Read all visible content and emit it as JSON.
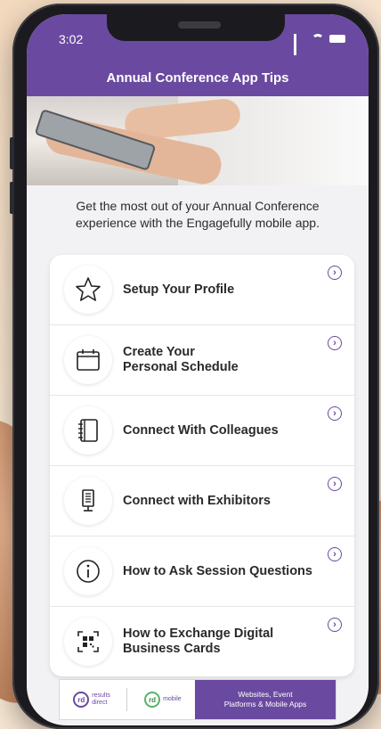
{
  "status_bar": {
    "time": "3:02"
  },
  "header": {
    "title": "Annual Conference App Tips"
  },
  "intro": {
    "line1": "Get the most out of your Annual Conference",
    "line2": "experience with the Engagefully mobile app."
  },
  "items": [
    {
      "line1": "Setup Your Profile",
      "line2": "",
      "icon": "star-icon"
    },
    {
      "line1": "Create Your",
      "line2": "Personal Schedule",
      "icon": "calendar-icon"
    },
    {
      "line1": "Connect With Colleagues",
      "line2": "",
      "icon": "notebook-icon"
    },
    {
      "line1": "Connect with Exhibitors",
      "line2": "",
      "icon": "booth-sign-icon"
    },
    {
      "line1": "How to Ask Session Questions",
      "line2": "",
      "icon": "info-icon"
    },
    {
      "line1": "How to Exchange Digital",
      "line2": "Business Cards",
      "icon": "qr-code-icon"
    }
  ],
  "footer": {
    "logo1_mark": "rd",
    "logo1_text_1": "results",
    "logo1_text_2": "direct",
    "logo2_mark": "rd",
    "logo2_text": "mobile",
    "tagline_1": "Websites, Event",
    "tagline_2": "Platforms & Mobile Apps"
  },
  "colors": {
    "accent": "#6a4aa0",
    "screen_bg": "#f2f2f4"
  }
}
